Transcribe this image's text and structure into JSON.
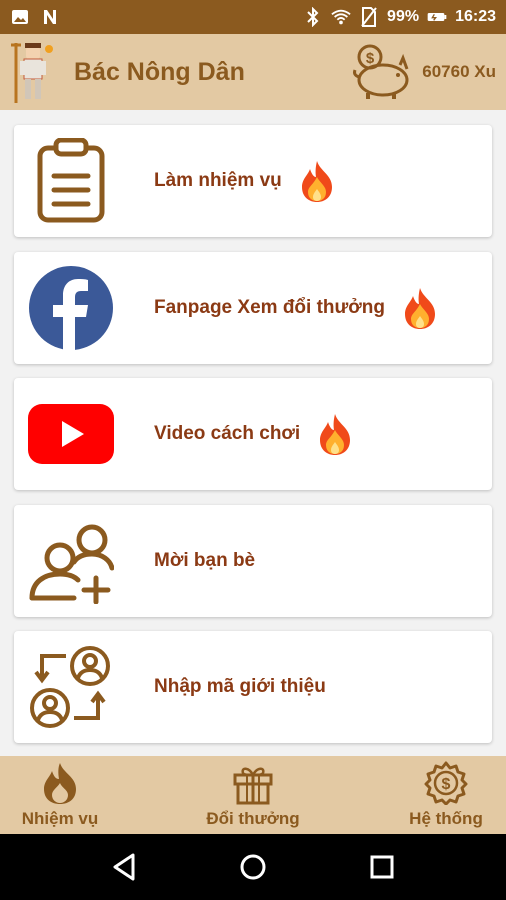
{
  "status_bar": {
    "battery": "99%",
    "time": "16:23",
    "icons": [
      "image-icon",
      "n-icon",
      "bluetooth-icon",
      "wifi-icon",
      "no-sim-icon",
      "battery-icon"
    ]
  },
  "header": {
    "title": "Bác Nông Dân",
    "coins": "60760 Xu"
  },
  "menu": {
    "items": [
      {
        "label": "Làm nhiệm vụ",
        "icon": "clipboard-icon",
        "hot": true
      },
      {
        "label": "Fanpage Xem đổi thưởng",
        "icon": "facebook-icon",
        "hot": true
      },
      {
        "label": "Video cách chơi",
        "icon": "youtube-icon",
        "hot": true
      },
      {
        "label": "Mời bạn bè",
        "icon": "add-friend-icon",
        "hot": false
      },
      {
        "label": "Nhập mã giới thiệu",
        "icon": "referral-code-icon",
        "hot": false
      }
    ]
  },
  "bottom_nav": {
    "tabs": [
      {
        "label": "Nhiệm vụ",
        "icon": "fire-icon"
      },
      {
        "label": "Đổi thưởng",
        "icon": "gift-icon"
      },
      {
        "label": "Hệ thống",
        "icon": "settings-coin-icon"
      }
    ]
  },
  "colors": {
    "brown": "#8b5a1f",
    "tan": "#e3c9a3",
    "label": "#8b3a14",
    "facebook": "#3b5998",
    "youtube": "#ff0000"
  }
}
